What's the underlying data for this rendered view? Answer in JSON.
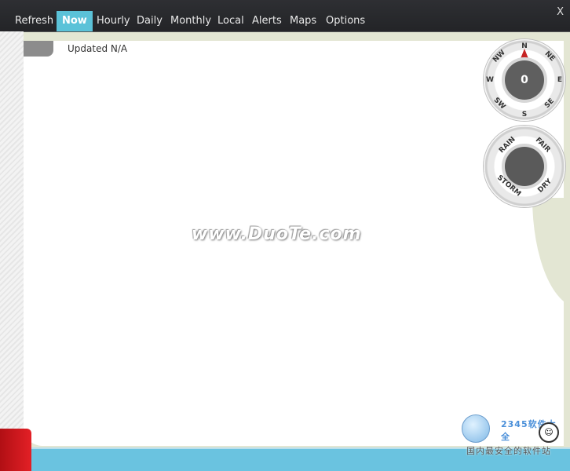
{
  "nav": {
    "items": [
      {
        "label": "Refresh"
      },
      {
        "label": "Now"
      },
      {
        "label": "Hourly"
      },
      {
        "label": "Daily"
      },
      {
        "label": "Monthly"
      },
      {
        "label": "Local"
      },
      {
        "label": "Alerts"
      },
      {
        "label": "Maps"
      },
      {
        "label": "Options"
      }
    ],
    "active": "Now",
    "close_label": "X"
  },
  "status": {
    "updated_text": "Updated N/A"
  },
  "compass": {
    "labels": {
      "n": "N",
      "ne": "NE",
      "e": "E",
      "se": "SE",
      "s": "S",
      "sw": "SW",
      "w": "W",
      "nw": "NW"
    },
    "value": "0"
  },
  "barometer": {
    "labels": {
      "rain": "RAIN",
      "fair": "FAIR",
      "storm": "STORM",
      "dry": "DRY"
    }
  },
  "watermark": {
    "text": "www.DuoTe.com",
    "logo_text": "2345软件大全",
    "logo_sub": "国内最安全的软件站"
  },
  "colors": {
    "nav_bg": "#2e2f33",
    "active_tab": "#5bc2d8",
    "bottom_bar": "#6ac3e0",
    "left_accent": "#e32026",
    "needle": "#c62424"
  },
  "icons": {
    "close": "close-icon",
    "compass_needle": "compass-needle-icon"
  }
}
